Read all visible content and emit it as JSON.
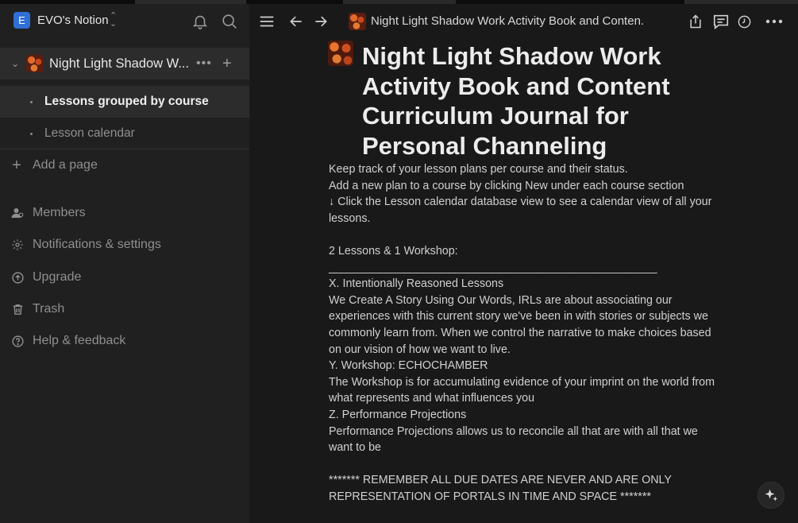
{
  "workspace": {
    "badge": "E",
    "name": "EVO's Notion"
  },
  "sidebar": {
    "page": {
      "title": "Night Light Shadow W...",
      "more": "•••",
      "add": "+"
    },
    "views": [
      {
        "label": "Lessons grouped by course",
        "active": true
      },
      {
        "label": "Lesson calendar",
        "active": false
      }
    ],
    "add_page": "Add a page",
    "items": [
      {
        "label": "Members",
        "icon": "members-icon"
      },
      {
        "label": "Notifications & settings",
        "icon": "settings-icon"
      },
      {
        "label": "Upgrade",
        "icon": "upgrade-icon"
      },
      {
        "label": "Trash",
        "icon": "trash-icon"
      },
      {
        "label": "Help & feedback",
        "icon": "help-icon"
      }
    ]
  },
  "topbar": {
    "breadcrumb": "Night Light Shadow Work Activity Book and Conten..."
  },
  "page": {
    "title": "Night Light Shadow Work Activity Book and Content Curriculum Journal for Personal Channeling",
    "lines": [
      "Keep track of your lesson plans per course and their status.",
      "Add a new plan to a course by clicking New under each course section",
      "↓ Click the Lesson calendar database view to see a calendar view of all your",
      "lessons.",
      "",
      "2 Lessons & 1 Workshop:",
      "____________________________________________________",
      "X. Intentionally Reasoned Lessons",
      "We Create A Story Using Our Words, IRLs are about associating our",
      "experiences with this current story we've been in with stories or subjects we",
      "commonly learn from. When we control the narrative to make choices based",
      "on our vision of how we want to live.",
      "Y. Workshop: ECHOCHAMBER",
      "The Workshop is for accumulating evidence of your imprint on the world from",
      "what represents and what influences you",
      "Z. Performance Projections",
      "Performance Projections allows us to reconcile all that are with all that we",
      "want to be",
      "",
      "******* REMEMBER ALL DUE DATES ARE NEVER AND ARE ONLY",
      "REPRESENTATION OF PORTALS IN TIME AND SPACE *******"
    ]
  }
}
